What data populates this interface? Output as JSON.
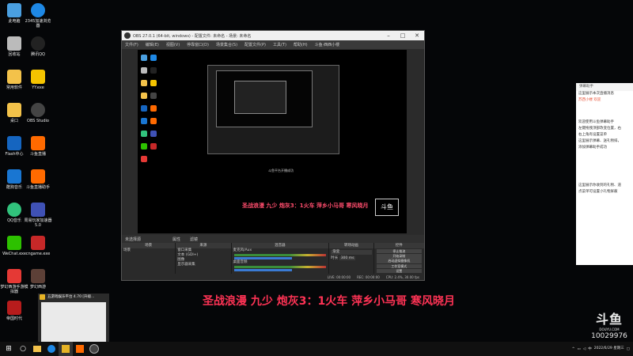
{
  "desktop_icons": [
    {
      "label": "此电脑",
      "color": "#4a9fe0"
    },
    {
      "label": "2345加速浏览器",
      "color": "#1e88e5"
    },
    {
      "label": "回收站",
      "color": "#bbbbbb"
    },
    {
      "label": "腾讯QQ",
      "color": "#222222"
    },
    {
      "label": "常用软件",
      "color": "#f3c24a"
    },
    {
      "label": "YY.exe",
      "color": "#f5c400"
    },
    {
      "label": "桌口",
      "color": "#f3c24a"
    },
    {
      "label": "OBS Studio",
      "color": "#444444"
    },
    {
      "label": "Flash中心",
      "color": "#1565c0"
    },
    {
      "label": "斗鱼直播",
      "color": "#ff6a00"
    },
    {
      "label": "酷狗音乐",
      "color": "#1976d2"
    },
    {
      "label": "斗鱼直播助手",
      "color": "#ff6a00"
    },
    {
      "label": "QQ音乐",
      "color": "#31c27c"
    },
    {
      "label": "周易玩家加速器5.0",
      "color": "#3f51b5"
    },
    {
      "label": "WeChat.exe",
      "color": "#2dc100"
    },
    {
      "label": "cngame.exe",
      "color": "#c62828"
    },
    {
      "label": "梦幻西游手游模拟器",
      "color": "#e53935"
    },
    {
      "label": "梦幻西游",
      "color": "#5d4037"
    },
    {
      "label": "帝国时代",
      "color": "#b71c1c"
    }
  ],
  "obs": {
    "title": "OBS 27.0.1 (64-bit, windows) - 配置文件: 未命名 - 场景: 未命名",
    "menu": [
      "文件(F)",
      "编辑(E)",
      "视图(V)",
      "停靠窗口(D)",
      "场景集合(S)",
      "配置文件(P)",
      "工具(T)",
      "帮助(H)",
      "斗鱼·西西小楼"
    ],
    "preview_overlay_text": "圣战浪漫 九少 炮灰3：1火车 萍乡小马哥 寒风晓月",
    "preview_small_text": "斗鱼平台开播成功",
    "docks_header": [
      "未选择源",
      "属性",
      "滤镜"
    ],
    "scenes": {
      "title": "场景",
      "items": [
        "场景"
      ]
    },
    "sources": {
      "title": "来源",
      "items": [
        "窗口采集",
        "文本 (GDI+)",
        "图像",
        "显示器采集"
      ]
    },
    "mixer": {
      "title": "混音器",
      "tracks": [
        "麦克风/Aux",
        "桌面音频"
      ]
    },
    "transitions": {
      "title": "转场动画",
      "mode": "渐变",
      "duration_label": "时长",
      "duration": "300 ms"
    },
    "controls": {
      "title": "控件",
      "buttons": [
        "停止推流",
        "开始录制",
        "启动虚拟摄像机",
        "工作室模式",
        "设置",
        "退出"
      ]
    },
    "status": {
      "live": "LIVE: 00:00:00",
      "rec": "REC: 00:00:00",
      "cpu": "CPU: 2.4%, 30.00 fps"
    }
  },
  "caption": "圣战浪漫 九少 炮灰3：1火车 萍乡小马哥 寒风晓月",
  "chat": {
    "header": "弹幕助手",
    "rows": [
      "这里展示本次直播消息",
      "苏西小楼 欢迎",
      "欢迎使用斗鱼弹幕助手",
      "左键拖拽顶部改变位置，右",
      "右上角有设置菜单",
      "这里展示弹幕、送礼物排，",
      "添加弹幕助手成功",
      "这里展示你收到的礼物、道",
      "点菜单可设置小礼物屏蔽"
    ]
  },
  "watermark": {
    "logo": "斗鱼",
    "site": "DOUYU.COM",
    "room": "10029976"
  },
  "thumb": {
    "title": "五游戏娱乐平台 4.70 [升级..."
  },
  "taskbar": {
    "date": "2022/6/29 星期三"
  }
}
